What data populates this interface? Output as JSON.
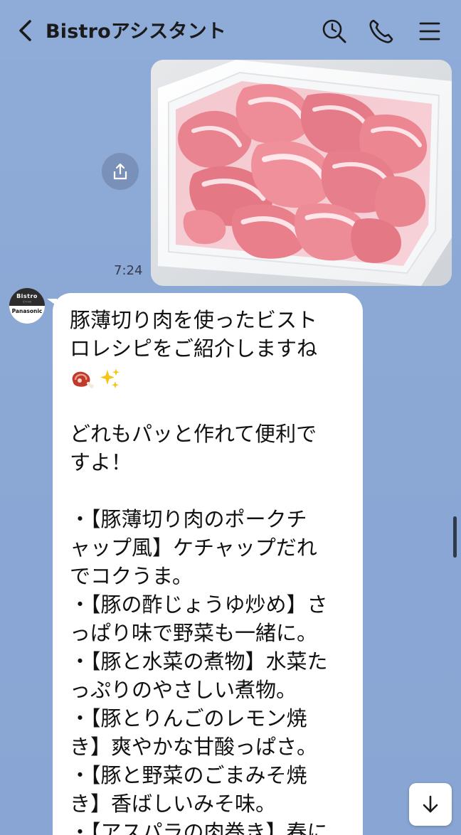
{
  "header": {
    "title": "Bistroアシスタント",
    "icons": [
      "back-arrow-icon",
      "search-icon",
      "phone-icon",
      "menu-icon"
    ]
  },
  "image_message": {
    "time": "7:24",
    "image": "raw-pork-slices-in-white-tray",
    "share_icon": "share-icon"
  },
  "bot": {
    "avatar_top": "Bistro",
    "avatar_sub": "ビストロ",
    "avatar_brand": "Panasonic"
  },
  "message": {
    "lines": [
      "豚薄切り肉を使ったビスト",
      "ロレシピをご紹介しますね",
      "",
      "",
      "どれもパッと作れて便利で",
      "すよ！",
      "",
      "・【豚薄切り肉のポークチ",
      "ャップ風】ケチャップだれ",
      "でコクうま。",
      "・【豚の酢じょうゆ炒め】さ",
      "っぱり味で野菜も一緒に。",
      "・【豚と水菜の煮物】水菜た",
      "っぷりのやさしい煮物。",
      "・【豚とりんごのレモン焼",
      "き】爽やかな甘酸っぱさ。",
      "・【豚と野菜のごまみそ焼",
      "き】香ばしいみそ味。",
      "・【アスパラの肉巻き】春に"
    ],
    "emojis": [
      "meat-on-bone-emoji",
      "sparkles-emoji"
    ]
  },
  "colors": {
    "background": "#8fabd8",
    "bubble": "#ffffff",
    "text": "#111111"
  },
  "controls": {
    "scroll_down_icon": "arrow-down-icon"
  }
}
